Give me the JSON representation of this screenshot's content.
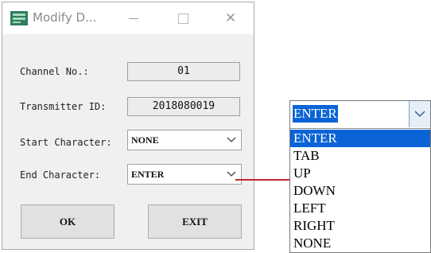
{
  "window": {
    "title": "Modify D...",
    "minimize_icon": "minimize-icon",
    "maximize_icon": "maximize-icon",
    "close_label": "✕"
  },
  "form": {
    "channel_label": "Channel No.:",
    "channel_value": "01",
    "transmitter_label": "Transmitter ID:",
    "transmitter_value": "2018080019",
    "start_label": "Start Character:",
    "start_value": "NONE",
    "end_label": "End Character:",
    "end_value": "ENTER"
  },
  "buttons": {
    "ok": "OK",
    "exit": "EXIT"
  },
  "dropdown": {
    "current": "ENTER",
    "options": [
      "ENTER",
      "TAB",
      "UP",
      "DOWN",
      "LEFT",
      "RIGHT",
      "NONE"
    ],
    "selected_index": 0
  },
  "colors": {
    "selection": "#0a64d6",
    "connector": "#c0282d"
  }
}
